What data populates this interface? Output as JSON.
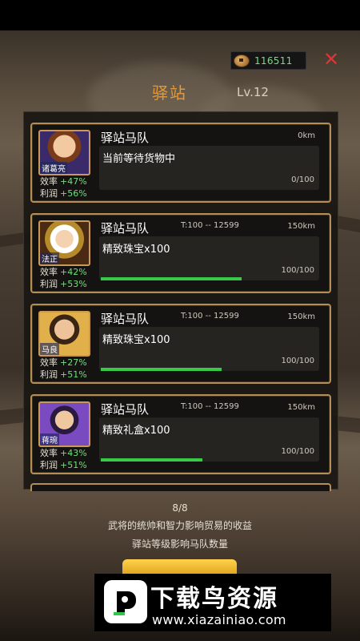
{
  "header": {
    "coins": "116511",
    "title": "驿站",
    "level": "Lv.12"
  },
  "cards": [
    {
      "hero": "诸葛亮",
      "efficiency": "+47%",
      "profit": "+56%",
      "name": "驿站马队",
      "range": "",
      "distance": "0km",
      "status": "当前等待货物中",
      "count": "0/100",
      "progress": 0
    },
    {
      "hero": "法正",
      "efficiency": "+42%",
      "profit": "+53%",
      "name": "驿站马队",
      "range": "T:100 -- 12599",
      "distance": "150km",
      "status": "精致珠宝x100",
      "count": "100/100",
      "progress": 0.65
    },
    {
      "hero": "马良",
      "efficiency": "+27%",
      "profit": "+51%",
      "name": "驿站马队",
      "range": "T:100 -- 12599",
      "distance": "150km",
      "status": "精致珠宝x100",
      "count": "100/100",
      "progress": 0.56
    },
    {
      "hero": "蒋琬",
      "efficiency": "+43%",
      "profit": "+51%",
      "name": "驿站马队",
      "range": "T:100 -- 12599",
      "distance": "150km",
      "status": "精致礼盒x100",
      "count": "100/100",
      "progress": 0.47
    }
  ],
  "labels": {
    "efficiency": "效率",
    "profit": "利润"
  },
  "footer": {
    "pager": "8/8",
    "info1": "武将的统帅和智力影响贸易的收益",
    "info2": "驿站等级影响马队数量"
  },
  "watermark": {
    "title": "下载鸟资源",
    "url": "www.xiazainiao.com"
  },
  "colors": {
    "accent": "#e39a3c",
    "positive": "#6fe07a",
    "card_border": "#b48e54",
    "progress": "#39c949",
    "close": "#d83838"
  }
}
